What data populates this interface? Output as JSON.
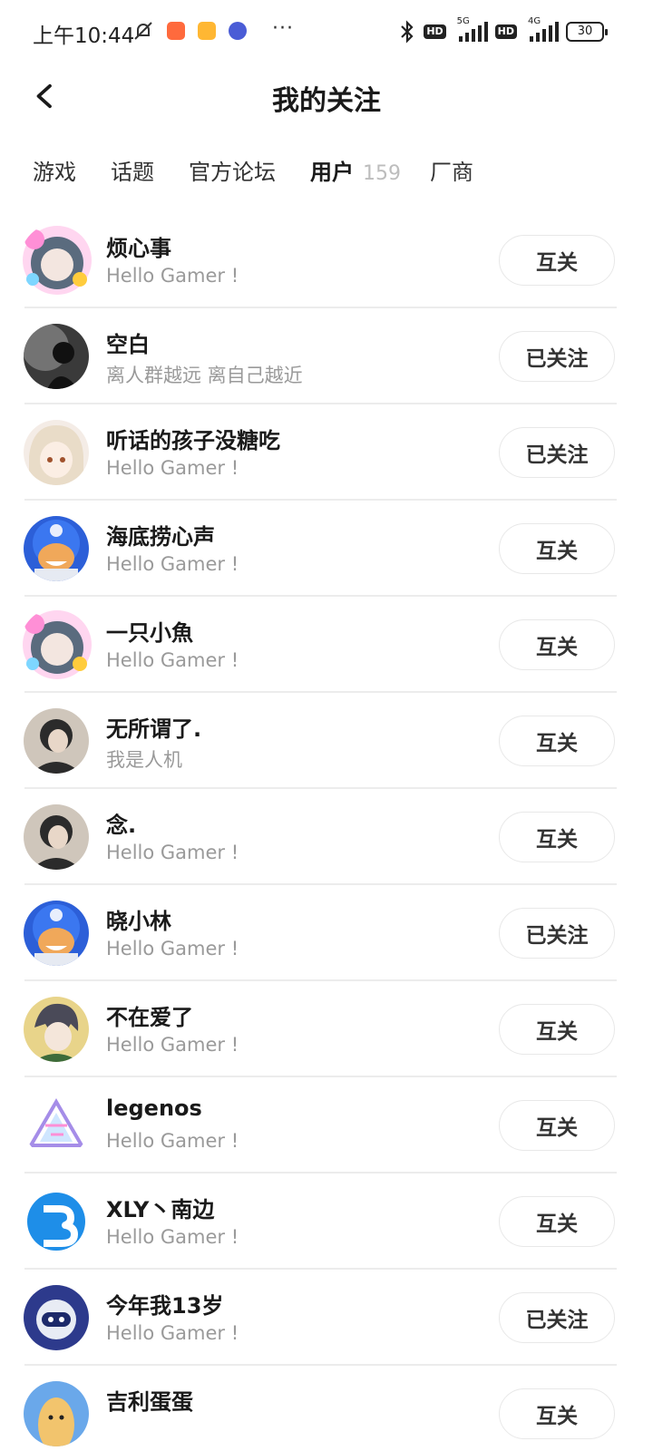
{
  "status_bar": {
    "time": "上午10:44",
    "battery": "30",
    "network_1": "5G",
    "network_2": "4G",
    "hd_label": "HD",
    "more": "···"
  },
  "header": {
    "title": "我的关注"
  },
  "tabs": [
    {
      "label": "游戏"
    },
    {
      "label": "话题"
    },
    {
      "label": "官方论坛"
    },
    {
      "label": "用户",
      "count": "159",
      "active": true
    },
    {
      "label": "厂商"
    }
  ],
  "colors": {
    "accent": "#1dd1b4",
    "muted_text": "#9a9a9a"
  },
  "users": [
    {
      "name": "烦心事",
      "bio": "Hello Gamer !",
      "button": "互关",
      "avatar": "anime-avatar-decorated-frame"
    },
    {
      "name": "空白",
      "bio": "离人群越远 离自己越近",
      "button": "已关注",
      "avatar": "dark-silhouette-avatar"
    },
    {
      "name": "听话的孩子没糖吃",
      "bio": "Hello Gamer !",
      "button": "已关注",
      "avatar": "anime-girl-avatar"
    },
    {
      "name": "海底捞心声",
      "bio": "Hello Gamer !",
      "button": "互关",
      "avatar": "default-blue-mascot-avatar"
    },
    {
      "name": "一只小魚",
      "bio": "Hello Gamer !",
      "button": "互关",
      "avatar": "anime-avatar-decorated-frame"
    },
    {
      "name": "无所谓了.",
      "bio": "我是人机",
      "button": "互关",
      "avatar": "person-photo-avatar"
    },
    {
      "name": "念.",
      "bio": "Hello Gamer !",
      "button": "互关",
      "avatar": "person-photo-avatar"
    },
    {
      "name": "晓小林",
      "bio": "Hello Gamer !",
      "button": "已关注",
      "avatar": "default-blue-mascot-avatar"
    },
    {
      "name": "不在爱了",
      "bio": "Hello Gamer !",
      "button": "互关",
      "avatar": "anime-boy-avatar"
    },
    {
      "name": "legenos",
      "bio": "Hello Gamer !",
      "button": "互关",
      "avatar": "triangle-logo-avatar"
    },
    {
      "name": "XLY丶南边",
      "bio": "Hello Gamer !",
      "button": "互关",
      "avatar": "blue-letter-logo-avatar"
    },
    {
      "name": "今年我13岁",
      "bio": "Hello Gamer !",
      "button": "已关注",
      "avatar": "robot-avatar"
    },
    {
      "name": "吉利蛋蛋",
      "bio": "",
      "button": "互关",
      "avatar": "cartoon-egg-avatar"
    }
  ]
}
